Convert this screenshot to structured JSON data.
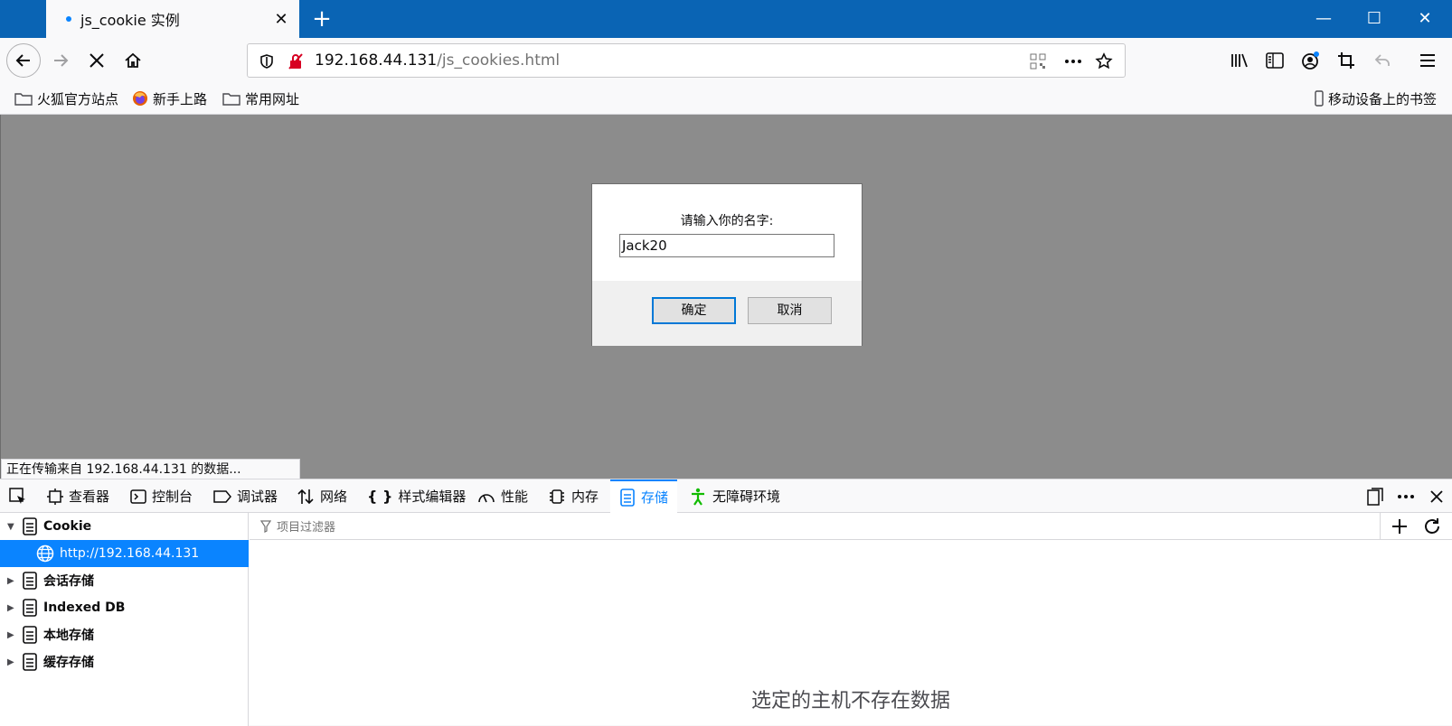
{
  "tab": {
    "title": "js_cookie 实例",
    "close_glyph": "✕"
  },
  "window": {
    "new_tab_glyph": "+",
    "minimize_glyph": "—",
    "maximize_glyph": "☐",
    "close_glyph": "✕"
  },
  "url": {
    "host": "192.168.44.131",
    "path": "/js_cookies.html"
  },
  "bookmarks": [
    {
      "label": "火狐官方站点",
      "icon": "folder-icon"
    },
    {
      "label": "新手上路",
      "icon": "firefox-icon"
    },
    {
      "label": "常用网址",
      "icon": "folder-icon"
    }
  ],
  "mobile_bookmarks": "移动设备上的书签",
  "dialog": {
    "message": "请输入你的名字:",
    "input_value": "Jack20",
    "ok_label": "确定",
    "cancel_label": "取消"
  },
  "status_text": "正在传输来自 192.168.44.131 的数据...",
  "devtools": {
    "tabs": [
      {
        "label": "查看器",
        "icon": "inspector-icon"
      },
      {
        "label": "控制台",
        "icon": "console-icon"
      },
      {
        "label": "调试器",
        "icon": "debugger-icon"
      },
      {
        "label": "网络",
        "icon": "network-icon"
      },
      {
        "label": "样式编辑器",
        "icon": "style-editor-icon"
      },
      {
        "label": "性能",
        "icon": "performance-icon"
      },
      {
        "label": "内存",
        "icon": "memory-icon"
      },
      {
        "label": "存储",
        "icon": "storage-icon",
        "active": true
      },
      {
        "label": "无障碍环境",
        "icon": "accessibility-icon"
      }
    ],
    "tree": [
      {
        "label": "Cookie",
        "expanded": true
      },
      {
        "label": "http://192.168.44.131",
        "selected": true
      },
      {
        "label": "会话存储"
      },
      {
        "label": "Indexed DB"
      },
      {
        "label": "本地存储"
      },
      {
        "label": "缓存存储"
      }
    ],
    "filter_placeholder": "项目过滤器",
    "empty_message": "选定的主机不存在数据"
  },
  "colors": {
    "accent": "#0a84ff",
    "titlebar": "#0a64b4",
    "content_overlay": "#8c8c8c"
  }
}
